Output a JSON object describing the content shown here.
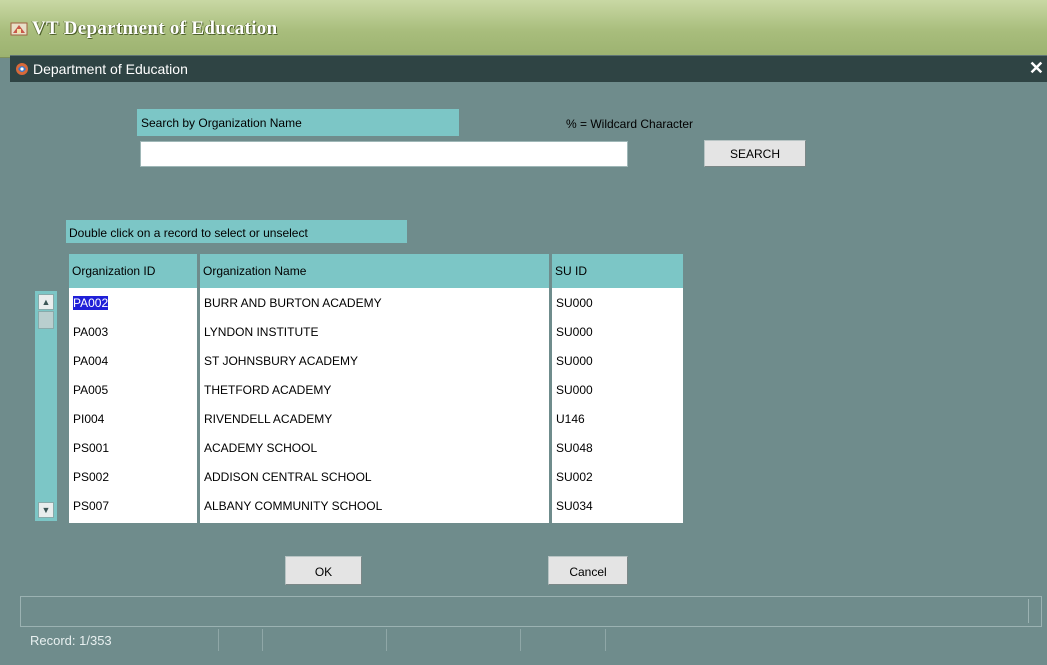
{
  "app": {
    "title": "VT Department of Education"
  },
  "window": {
    "title": "Department of Education",
    "close_glyph": "✕"
  },
  "search": {
    "label": "Search by Organization Name",
    "wildcard_hint": "% = Wildcard Character",
    "value": "",
    "button_label": "SEARCH"
  },
  "grid": {
    "instruction": "Double click on a record to select or unselect",
    "columns": [
      "Organization ID",
      "Organization Name",
      "SU ID"
    ],
    "rows": [
      {
        "id": "PA002",
        "name": "BURR AND BURTON ACADEMY",
        "su": "SU000",
        "selected": true
      },
      {
        "id": "PA003",
        "name": "LYNDON INSTITUTE",
        "su": "SU000"
      },
      {
        "id": "PA004",
        "name": "ST JOHNSBURY ACADEMY",
        "su": "SU000"
      },
      {
        "id": "PA005",
        "name": "THETFORD ACADEMY",
        "su": "SU000"
      },
      {
        "id": "PI004",
        "name": "RIVENDELL ACADEMY",
        "su": "U146"
      },
      {
        "id": "PS001",
        "name": "ACADEMY SCHOOL",
        "su": "SU048"
      },
      {
        "id": "PS002",
        "name": "ADDISON CENTRAL SCHOOL",
        "su": "SU002"
      },
      {
        "id": "PS007",
        "name": "ALBANY COMMUNITY SCHOOL",
        "su": "SU034"
      }
    ]
  },
  "buttons": {
    "ok": "OK",
    "cancel": "Cancel"
  },
  "status": {
    "record": "Record: 1/353"
  },
  "colors": {
    "background": "#6f8c8c",
    "label_bg": "#7cc6c6",
    "selection": "#1f1fd8",
    "titlebar": "#2f4444"
  }
}
